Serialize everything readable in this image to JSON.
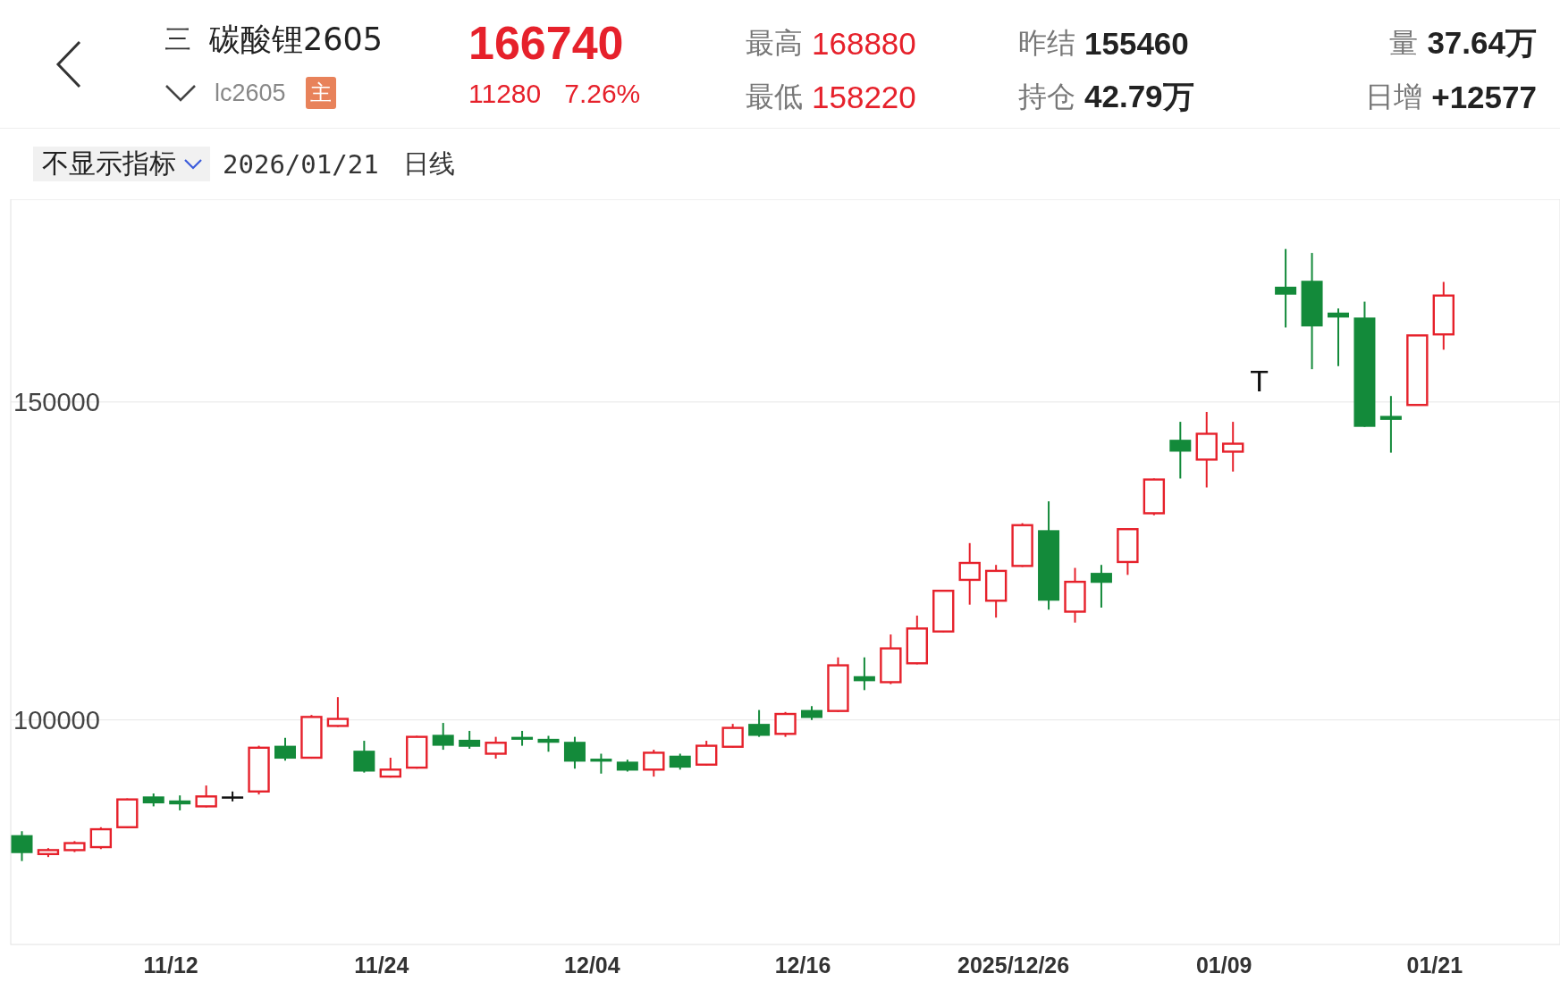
{
  "header": {
    "menu": "三",
    "name": "碳酸锂2605",
    "code": "lc2605",
    "badge": "主",
    "price": "166740",
    "change": "11280",
    "change_pct": "7.26%",
    "stats": [
      {
        "label": "最高",
        "value": "168880",
        "rising": true
      },
      {
        "label": "昨结",
        "value": "155460",
        "rising": false
      },
      {
        "label": "量",
        "value": "37.64万",
        "rising": false
      },
      {
        "label": "最低",
        "value": "158220",
        "rising": true
      },
      {
        "label": "持仓",
        "value": "42.79万",
        "rising": false
      },
      {
        "label": "日增",
        "value": "+12577",
        "rising": false
      }
    ]
  },
  "toolbar": {
    "indicator": "不显示指标",
    "date": "2026/01/21",
    "period": "日线"
  },
  "chart": {
    "y_labels": [
      "150000",
      "100000"
    ],
    "marker": "T",
    "x_labels": [
      "11/12",
      "11/24",
      "12/04",
      "12/16",
      "2025/12/26",
      "01/09",
      "01/21"
    ]
  }
}
